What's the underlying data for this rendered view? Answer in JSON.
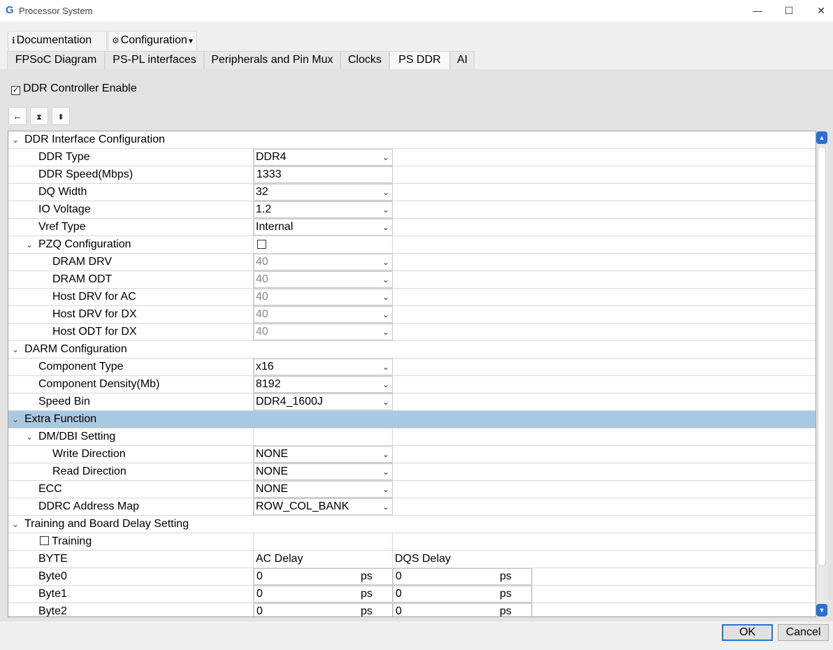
{
  "window": {
    "title": "Processor System",
    "app_icon": "G",
    "controls": {
      "minimize": "—",
      "maximize": "☐",
      "close": "✕"
    }
  },
  "menu": {
    "documentation": {
      "icon": "info-icon",
      "label": "Documentation"
    },
    "configuration": {
      "icon": "gear-icon",
      "label": "Configuration"
    }
  },
  "tabs": [
    {
      "label": "FPSoC Diagram",
      "active": false
    },
    {
      "label": "PS-PL interfaces",
      "active": false
    },
    {
      "label": "Peripherals and Pin Mux",
      "active": false
    },
    {
      "label": "Clocks",
      "active": false
    },
    {
      "label": "PS DDR",
      "active": true
    },
    {
      "label": "AI",
      "active": false
    }
  ],
  "ddr_enable": {
    "label": "DDR Controller Enable",
    "checked": true
  },
  "toolbar": {
    "back_icon": "arrow-left-icon",
    "collapse_icon": "collapse-all-icon",
    "expand_icon": "expand-all-icon"
  },
  "tree": {
    "ddr_interface": {
      "label": "DDR Interface Configuration",
      "ddr_type": {
        "label": "DDR Type",
        "value": "DDR4"
      },
      "ddr_speed": {
        "label": "DDR Speed(Mbps)",
        "value": "1333"
      },
      "dq_width": {
        "label": "DQ Width",
        "value": "32"
      },
      "io_voltage": {
        "label": "IO Voltage",
        "value": "1.2"
      },
      "vref_type": {
        "label": "Vref Type",
        "value": "Internal"
      },
      "pzq": {
        "label": "PZQ Configuration",
        "checked": false,
        "dram_drv": {
          "label": "DRAM DRV",
          "value": "40"
        },
        "dram_odt": {
          "label": "DRAM ODT",
          "value": "40"
        },
        "host_drv_ac": {
          "label": "Host DRV for AC",
          "value": "40"
        },
        "host_drv_dx": {
          "label": "Host DRV for DX",
          "value": "40"
        },
        "host_odt_dx": {
          "label": "Host ODT for DX",
          "value": "40"
        }
      }
    },
    "darm": {
      "label": "DARM Configuration",
      "component_type": {
        "label": "Component Type",
        "value": "x16"
      },
      "component_density": {
        "label": "Component Density(Mb)",
        "value": "8192"
      },
      "speed_bin": {
        "label": "Speed Bin",
        "value": "DDR4_1600J"
      }
    },
    "extra": {
      "label": "Extra Function",
      "dm_dbi": {
        "label": "DM/DBI Setting",
        "write_direction": {
          "label": "Write Direction",
          "value": "NONE"
        },
        "read_direction": {
          "label": "Read Direction",
          "value": "NONE"
        }
      },
      "ecc": {
        "label": "ECC",
        "value": "NONE"
      },
      "address_map": {
        "label": "DDRC Address Map",
        "value": "ROW_COL_BANK"
      }
    },
    "training": {
      "label": "Training and Board Delay Setting",
      "training_check": {
        "label": "Training",
        "checked": false
      },
      "header": {
        "byte": "BYTE",
        "ac_delay": "AC Delay",
        "dqs_delay": "DQS Delay"
      },
      "unit": "ps",
      "bytes": [
        {
          "label": "Byte0",
          "ac": "0",
          "dqs": "0"
        },
        {
          "label": "Byte1",
          "ac": "0",
          "dqs": "0"
        },
        {
          "label": "Byte2",
          "ac": "0",
          "dqs": "0"
        }
      ]
    }
  },
  "buttons": {
    "ok": "OK",
    "cancel": "Cancel"
  },
  "colors": {
    "selection": "#a9c8e2",
    "accent": "#2f72c9"
  }
}
